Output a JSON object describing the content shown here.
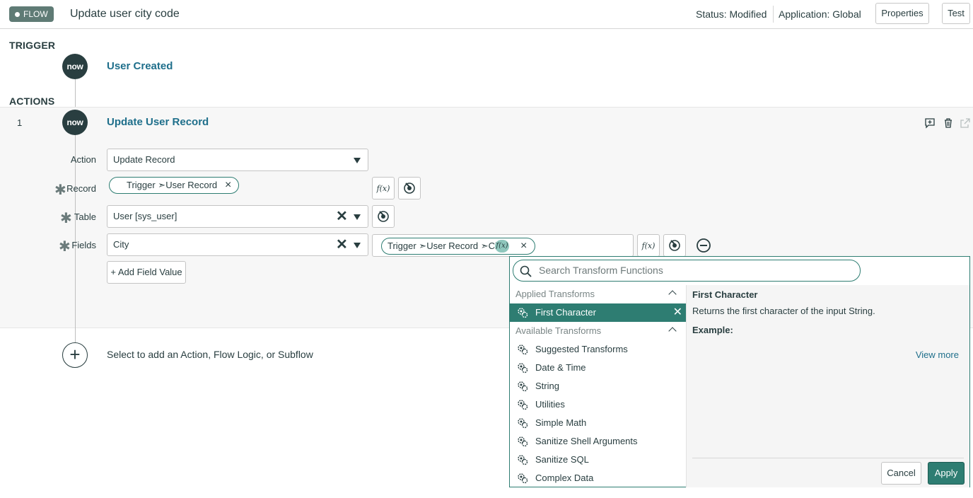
{
  "header": {
    "badge": "FLOW",
    "title": "Update user city code",
    "status": "Status: Modified",
    "application": "Application: Global",
    "properties_label": "Properties",
    "test_label": "Test"
  },
  "trigger": {
    "section_label": "TRIGGER",
    "logo_text": "now",
    "title": "User Created"
  },
  "actions": {
    "section_label": "ACTIONS",
    "index": "1",
    "logo_text": "now",
    "title": "Update User Record",
    "action_label": "Action",
    "action_value": "Update Record",
    "record_label": "Record",
    "record_pill": "Trigger ➣User Record",
    "table_label": "Table",
    "table_value": "User [sys_user]",
    "fields_label": "Fields",
    "fields_value": "City",
    "fields_pill": "Trigger ➣User Record ➣City",
    "fx_label": "f(x)",
    "add_field_label": "+ Add Field Value"
  },
  "add_step": {
    "label": "Select to add an Action, Flow Logic, or Subflow"
  },
  "transform_panel": {
    "search_placeholder": "Search Transform Functions",
    "applied_header": "Applied Transforms",
    "applied": [
      "First Character"
    ],
    "available_header": "Available Transforms",
    "available": [
      "Suggested Transforms",
      "Date & Time",
      "String",
      "Utilities",
      "Simple Math",
      "Sanitize Shell Arguments",
      "Sanitize SQL",
      "Complex Data"
    ],
    "detail_title": "First Character",
    "detail_desc": "Returns the first character of the input String.",
    "example_label": "Example:",
    "view_more": "View more",
    "cancel_label": "Cancel",
    "apply_label": "Apply"
  },
  "colors": {
    "accent": "#2e7d72",
    "link": "#1f6f8b",
    "text": "#293e40"
  }
}
